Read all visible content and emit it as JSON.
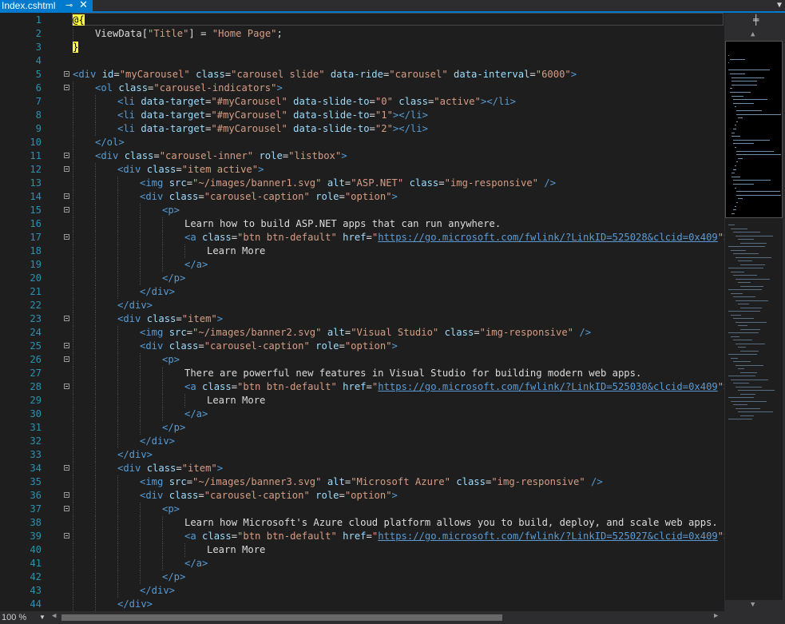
{
  "tab": {
    "title": "Index.cshtml",
    "pin_icon": "pin-icon",
    "close_icon": "close-icon"
  },
  "statusbar": {
    "zoom": "100 %"
  },
  "colors": {
    "tag": "#569cd6",
    "attribute": "#9cdcfe",
    "value": "#d69d85",
    "line_number": "#2b91af",
    "accent": "#007acc"
  },
  "lines": [
    {
      "n": "1",
      "fold": false,
      "indent": 0,
      "tokens": [
        [
          "razor",
          "@{"
        ]
      ]
    },
    {
      "n": "2",
      "fold": false,
      "indent": 1,
      "tokens": [
        [
          "txt",
          "ViewData["
        ],
        [
          "val",
          "\"Title\""
        ],
        [
          "txt",
          "] = "
        ],
        [
          "val",
          "\"Home Page\""
        ],
        [
          "txt",
          ";"
        ]
      ]
    },
    {
      "n": "3",
      "fold": false,
      "indent": 0,
      "tokens": [
        [
          "razor",
          "}"
        ]
      ]
    },
    {
      "n": "4",
      "fold": false,
      "indent": 0,
      "tokens": []
    },
    {
      "n": "5",
      "fold": true,
      "indent": 0,
      "tokens": [
        [
          "tag",
          "<div "
        ],
        [
          "attr",
          "id"
        ],
        [
          "txt",
          "="
        ],
        [
          "val",
          "\"myCarousel\""
        ],
        [
          "txt",
          " "
        ],
        [
          "attr",
          "class"
        ],
        [
          "txt",
          "="
        ],
        [
          "val",
          "\"carousel slide\""
        ],
        [
          "txt",
          " "
        ],
        [
          "attr",
          "data-ride"
        ],
        [
          "txt",
          "="
        ],
        [
          "val",
          "\"carousel\""
        ],
        [
          "txt",
          " "
        ],
        [
          "attr",
          "data-interval"
        ],
        [
          "txt",
          "="
        ],
        [
          "val",
          "\"6000\""
        ],
        [
          "tag",
          ">"
        ]
      ]
    },
    {
      "n": "6",
      "fold": true,
      "indent": 1,
      "tokens": [
        [
          "tag",
          "<ol "
        ],
        [
          "attr",
          "class"
        ],
        [
          "txt",
          "="
        ],
        [
          "val",
          "\"carousel-indicators\""
        ],
        [
          "tag",
          ">"
        ]
      ]
    },
    {
      "n": "7",
      "fold": false,
      "indent": 2,
      "tokens": [
        [
          "tag",
          "<li "
        ],
        [
          "attr",
          "data-target"
        ],
        [
          "txt",
          "="
        ],
        [
          "val",
          "\"#myCarousel\""
        ],
        [
          "txt",
          " "
        ],
        [
          "attr",
          "data-slide-to"
        ],
        [
          "txt",
          "="
        ],
        [
          "val",
          "\"0\""
        ],
        [
          "txt",
          " "
        ],
        [
          "attr",
          "class"
        ],
        [
          "txt",
          "="
        ],
        [
          "val",
          "\"active\""
        ],
        [
          "tag",
          "></li>"
        ]
      ]
    },
    {
      "n": "8",
      "fold": false,
      "indent": 2,
      "tokens": [
        [
          "tag",
          "<li "
        ],
        [
          "attr",
          "data-target"
        ],
        [
          "txt",
          "="
        ],
        [
          "val",
          "\"#myCarousel\""
        ],
        [
          "txt",
          " "
        ],
        [
          "attr",
          "data-slide-to"
        ],
        [
          "txt",
          "="
        ],
        [
          "val",
          "\"1\""
        ],
        [
          "tag",
          "></li>"
        ]
      ]
    },
    {
      "n": "9",
      "fold": false,
      "indent": 2,
      "tokens": [
        [
          "tag",
          "<li "
        ],
        [
          "attr",
          "data-target"
        ],
        [
          "txt",
          "="
        ],
        [
          "val",
          "\"#myCarousel\""
        ],
        [
          "txt",
          " "
        ],
        [
          "attr",
          "data-slide-to"
        ],
        [
          "txt",
          "="
        ],
        [
          "val",
          "\"2\""
        ],
        [
          "tag",
          "></li>"
        ]
      ]
    },
    {
      "n": "10",
      "fold": false,
      "indent": 1,
      "tokens": [
        [
          "tag",
          "</ol>"
        ]
      ]
    },
    {
      "n": "11",
      "fold": true,
      "indent": 1,
      "tokens": [
        [
          "tag",
          "<div "
        ],
        [
          "attr",
          "class"
        ],
        [
          "txt",
          "="
        ],
        [
          "val",
          "\"carousel-inner\""
        ],
        [
          "txt",
          " "
        ],
        [
          "attr",
          "role"
        ],
        [
          "txt",
          "="
        ],
        [
          "val",
          "\"listbox\""
        ],
        [
          "tag",
          ">"
        ]
      ]
    },
    {
      "n": "12",
      "fold": true,
      "indent": 2,
      "tokens": [
        [
          "tag",
          "<div "
        ],
        [
          "attr",
          "class"
        ],
        [
          "txt",
          "="
        ],
        [
          "val",
          "\"item active\""
        ],
        [
          "tag",
          ">"
        ]
      ]
    },
    {
      "n": "13",
      "fold": false,
      "indent": 3,
      "tokens": [
        [
          "tag",
          "<img "
        ],
        [
          "attr",
          "src"
        ],
        [
          "txt",
          "="
        ],
        [
          "val",
          "\"~/images/banner1.svg\""
        ],
        [
          "txt",
          " "
        ],
        [
          "attr",
          "alt"
        ],
        [
          "txt",
          "="
        ],
        [
          "val",
          "\"ASP.NET\""
        ],
        [
          "txt",
          " "
        ],
        [
          "attr",
          "class"
        ],
        [
          "txt",
          "="
        ],
        [
          "val",
          "\"img-responsive\""
        ],
        [
          "tag",
          " />"
        ]
      ]
    },
    {
      "n": "14",
      "fold": true,
      "indent": 3,
      "tokens": [
        [
          "tag",
          "<div "
        ],
        [
          "attr",
          "class"
        ],
        [
          "txt",
          "="
        ],
        [
          "val",
          "\"carousel-caption\""
        ],
        [
          "txt",
          " "
        ],
        [
          "attr",
          "role"
        ],
        [
          "txt",
          "="
        ],
        [
          "val",
          "\"option\""
        ],
        [
          "tag",
          ">"
        ]
      ]
    },
    {
      "n": "15",
      "fold": true,
      "indent": 4,
      "tokens": [
        [
          "tag",
          "<p>"
        ]
      ]
    },
    {
      "n": "16",
      "fold": false,
      "indent": 5,
      "tokens": [
        [
          "txt",
          "Learn how to build ASP.NET apps that can run anywhere."
        ]
      ]
    },
    {
      "n": "17",
      "fold": true,
      "indent": 5,
      "tokens": [
        [
          "tag",
          "<a "
        ],
        [
          "attr",
          "class"
        ],
        [
          "txt",
          "="
        ],
        [
          "val",
          "\"btn btn-default\""
        ],
        [
          "txt",
          " "
        ],
        [
          "attr",
          "href"
        ],
        [
          "txt",
          "="
        ],
        [
          "val",
          "\""
        ],
        [
          "url",
          "https://go.microsoft.com/fwlink/?LinkID=525028&clcid=0x409"
        ],
        [
          "val",
          "\""
        ],
        [
          "tag",
          ">"
        ]
      ]
    },
    {
      "n": "18",
      "fold": false,
      "indent": 6,
      "tokens": [
        [
          "txt",
          "Learn More"
        ]
      ]
    },
    {
      "n": "19",
      "fold": false,
      "indent": 5,
      "tokens": [
        [
          "tag",
          "</a>"
        ]
      ]
    },
    {
      "n": "20",
      "fold": false,
      "indent": 4,
      "tokens": [
        [
          "tag",
          "</p>"
        ]
      ]
    },
    {
      "n": "21",
      "fold": false,
      "indent": 3,
      "tokens": [
        [
          "tag",
          "</div>"
        ]
      ]
    },
    {
      "n": "22",
      "fold": false,
      "indent": 2,
      "tokens": [
        [
          "tag",
          "</div>"
        ]
      ]
    },
    {
      "n": "23",
      "fold": true,
      "indent": 2,
      "tokens": [
        [
          "tag",
          "<div "
        ],
        [
          "attr",
          "class"
        ],
        [
          "txt",
          "="
        ],
        [
          "val",
          "\"item\""
        ],
        [
          "tag",
          ">"
        ]
      ]
    },
    {
      "n": "24",
      "fold": false,
      "indent": 3,
      "tokens": [
        [
          "tag",
          "<img "
        ],
        [
          "attr",
          "src"
        ],
        [
          "txt",
          "="
        ],
        [
          "val",
          "\"~/images/banner2.svg\""
        ],
        [
          "txt",
          " "
        ],
        [
          "attr",
          "alt"
        ],
        [
          "txt",
          "="
        ],
        [
          "val",
          "\"Visual Studio\""
        ],
        [
          "txt",
          " "
        ],
        [
          "attr",
          "class"
        ],
        [
          "txt",
          "="
        ],
        [
          "val",
          "\"img-responsive\""
        ],
        [
          "tag",
          " />"
        ]
      ]
    },
    {
      "n": "25",
      "fold": true,
      "indent": 3,
      "tokens": [
        [
          "tag",
          "<div "
        ],
        [
          "attr",
          "class"
        ],
        [
          "txt",
          "="
        ],
        [
          "val",
          "\"carousel-caption\""
        ],
        [
          "txt",
          " "
        ],
        [
          "attr",
          "role"
        ],
        [
          "txt",
          "="
        ],
        [
          "val",
          "\"option\""
        ],
        [
          "tag",
          ">"
        ]
      ]
    },
    {
      "n": "26",
      "fold": true,
      "indent": 4,
      "tokens": [
        [
          "tag",
          "<p>"
        ]
      ]
    },
    {
      "n": "27",
      "fold": false,
      "indent": 5,
      "tokens": [
        [
          "txt",
          "There are powerful new features in Visual Studio for building modern web apps."
        ]
      ]
    },
    {
      "n": "28",
      "fold": true,
      "indent": 5,
      "tokens": [
        [
          "tag",
          "<a "
        ],
        [
          "attr",
          "class"
        ],
        [
          "txt",
          "="
        ],
        [
          "val",
          "\"btn btn-default\""
        ],
        [
          "txt",
          " "
        ],
        [
          "attr",
          "href"
        ],
        [
          "txt",
          "="
        ],
        [
          "val",
          "\""
        ],
        [
          "url",
          "https://go.microsoft.com/fwlink/?LinkID=525030&clcid=0x409"
        ],
        [
          "val",
          "\""
        ],
        [
          "tag",
          ">"
        ]
      ]
    },
    {
      "n": "29",
      "fold": false,
      "indent": 6,
      "tokens": [
        [
          "txt",
          "Learn More"
        ]
      ]
    },
    {
      "n": "30",
      "fold": false,
      "indent": 5,
      "tokens": [
        [
          "tag",
          "</a>"
        ]
      ]
    },
    {
      "n": "31",
      "fold": false,
      "indent": 4,
      "tokens": [
        [
          "tag",
          "</p>"
        ]
      ]
    },
    {
      "n": "32",
      "fold": false,
      "indent": 3,
      "tokens": [
        [
          "tag",
          "</div>"
        ]
      ]
    },
    {
      "n": "33",
      "fold": false,
      "indent": 2,
      "tokens": [
        [
          "tag",
          "</div>"
        ]
      ]
    },
    {
      "n": "34",
      "fold": true,
      "indent": 2,
      "tokens": [
        [
          "tag",
          "<div "
        ],
        [
          "attr",
          "class"
        ],
        [
          "txt",
          "="
        ],
        [
          "val",
          "\"item\""
        ],
        [
          "tag",
          ">"
        ]
      ]
    },
    {
      "n": "35",
      "fold": false,
      "indent": 3,
      "tokens": [
        [
          "tag",
          "<img "
        ],
        [
          "attr",
          "src"
        ],
        [
          "txt",
          "="
        ],
        [
          "val",
          "\"~/images/banner3.svg\""
        ],
        [
          "txt",
          " "
        ],
        [
          "attr",
          "alt"
        ],
        [
          "txt",
          "="
        ],
        [
          "val",
          "\"Microsoft Azure\""
        ],
        [
          "txt",
          " "
        ],
        [
          "attr",
          "class"
        ],
        [
          "txt",
          "="
        ],
        [
          "val",
          "\"img-responsive\""
        ],
        [
          "tag",
          " />"
        ]
      ]
    },
    {
      "n": "36",
      "fold": true,
      "indent": 3,
      "tokens": [
        [
          "tag",
          "<div "
        ],
        [
          "attr",
          "class"
        ],
        [
          "txt",
          "="
        ],
        [
          "val",
          "\"carousel-caption\""
        ],
        [
          "txt",
          " "
        ],
        [
          "attr",
          "role"
        ],
        [
          "txt",
          "="
        ],
        [
          "val",
          "\"option\""
        ],
        [
          "tag",
          ">"
        ]
      ]
    },
    {
      "n": "37",
      "fold": true,
      "indent": 4,
      "tokens": [
        [
          "tag",
          "<p>"
        ]
      ]
    },
    {
      "n": "38",
      "fold": false,
      "indent": 5,
      "tokens": [
        [
          "txt",
          "Learn how Microsoft's Azure cloud platform allows you to build, deploy, and scale web apps."
        ]
      ]
    },
    {
      "n": "39",
      "fold": true,
      "indent": 5,
      "tokens": [
        [
          "tag",
          "<a "
        ],
        [
          "attr",
          "class"
        ],
        [
          "txt",
          "="
        ],
        [
          "val",
          "\"btn btn-default\""
        ],
        [
          "txt",
          " "
        ],
        [
          "attr",
          "href"
        ],
        [
          "txt",
          "="
        ],
        [
          "val",
          "\""
        ],
        [
          "url",
          "https://go.microsoft.com/fwlink/?LinkID=525027&clcid=0x409"
        ],
        [
          "val",
          "\""
        ],
        [
          "tag",
          ">"
        ]
      ]
    },
    {
      "n": "40",
      "fold": false,
      "indent": 6,
      "tokens": [
        [
          "txt",
          "Learn More"
        ]
      ]
    },
    {
      "n": "41",
      "fold": false,
      "indent": 5,
      "tokens": [
        [
          "tag",
          "</a>"
        ]
      ]
    },
    {
      "n": "42",
      "fold": false,
      "indent": 4,
      "tokens": [
        [
          "tag",
          "</p>"
        ]
      ]
    },
    {
      "n": "43",
      "fold": false,
      "indent": 3,
      "tokens": [
        [
          "tag",
          "</div>"
        ]
      ]
    },
    {
      "n": "44",
      "fold": false,
      "indent": 2,
      "tokens": [
        [
          "tag",
          "</div>"
        ]
      ]
    }
  ]
}
